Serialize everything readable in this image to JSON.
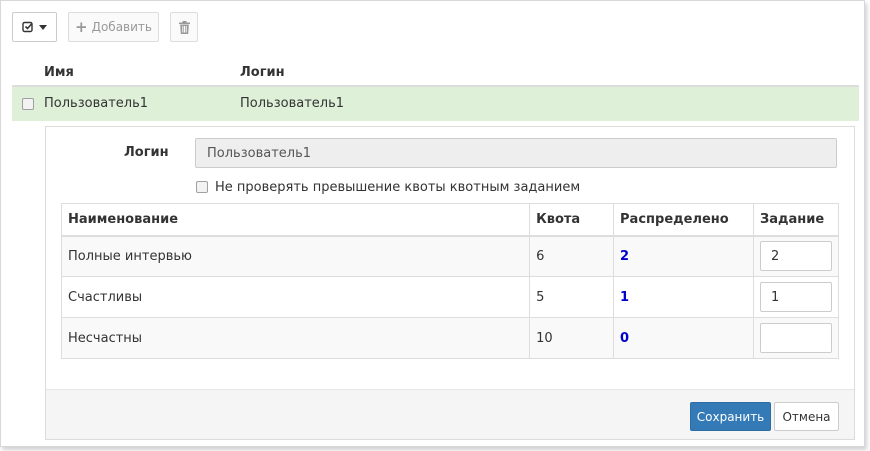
{
  "toolbar": {
    "select_icon": "check-square-icon",
    "add_label": "Добавить",
    "add_icon": "plus-icon",
    "delete_icon": "trash-icon"
  },
  "users_table": {
    "headers": {
      "name": "Имя",
      "login": "Логин"
    },
    "rows": [
      {
        "name": "Пользователь1",
        "login": "Пользователь1",
        "selected": true
      }
    ]
  },
  "detail": {
    "login_label": "Логин",
    "login_value": "Пользователь1",
    "skip_quota_check_label": "Не проверять превышение квоты квотным заданием",
    "skip_quota_check_checked": false,
    "quota_table": {
      "headers": [
        "Наименование",
        "Квота",
        "Распределено",
        "Задание"
      ],
      "rows": [
        {
          "name": "Полные интервью",
          "quota": "6",
          "distributed": "2",
          "task": "2"
        },
        {
          "name": "Счастливы",
          "quota": "5",
          "distributed": "1",
          "task": "1"
        },
        {
          "name": "Несчастны",
          "quota": "10",
          "distributed": "0",
          "task": ""
        }
      ]
    },
    "save_label": "Сохранить",
    "cancel_label": "Отмена"
  },
  "colors": {
    "selected_row": "#dff0d8",
    "primary": "#337ab7",
    "distributed_text": "#0000cc"
  }
}
